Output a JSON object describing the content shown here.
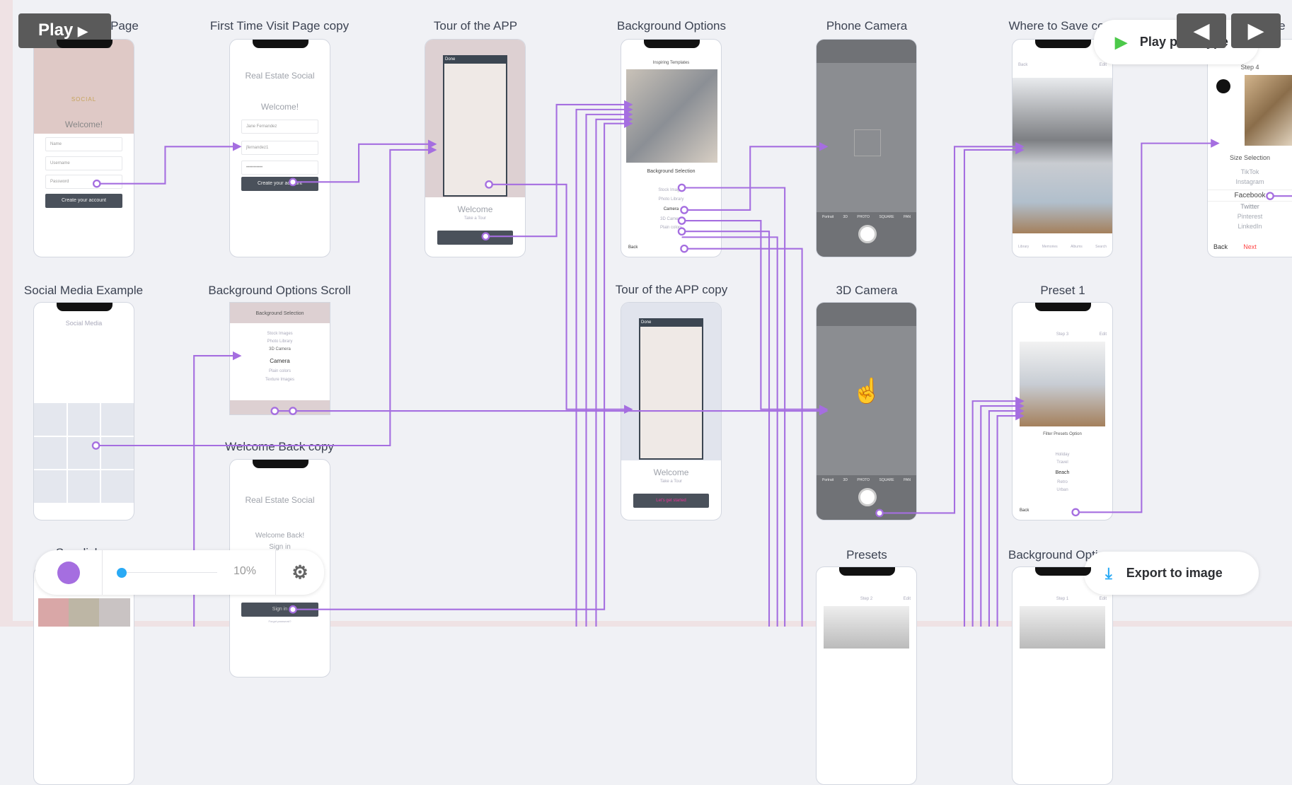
{
  "screens": {
    "s1": {
      "title": "First Time Visit Page",
      "brand": "SOCIAL",
      "welcome": "Welcome!",
      "name": "Name",
      "username": "Username",
      "password": "Password",
      "button": "Create your account"
    },
    "s2": {
      "title": "First Time Visit Page copy",
      "app": "Real Estate Social",
      "welcome": "Welcome!",
      "name": "Jane Fernandez",
      "username": "jfernandez1",
      "password": "•••••••••••",
      "button": "Create your account"
    },
    "s3": {
      "title": "Tour of the APP",
      "done": "Done",
      "welcome": "Welcome",
      "tour": "Take a Tour"
    },
    "s4": {
      "title": "Background Options",
      "header": "Inspiring Templates",
      "selection": "Background Selection",
      "items": [
        "Stock Images",
        "Photo Library",
        "Camera",
        "3D Camera",
        "Plain colors"
      ],
      "back": "Back"
    },
    "s5": {
      "title": "Phone Camera",
      "modes": [
        "Portrait",
        "3D",
        "PHOTO",
        "SQUARE",
        "PAN"
      ]
    },
    "s6": {
      "title": "Where to Save copy",
      "back": "Back",
      "edit": "Edit",
      "tabs": [
        "Library",
        "Memories",
        "Albums",
        "Search"
      ]
    },
    "s7": {
      "title": "Size",
      "step": "Step 4",
      "selection": "Size Selection",
      "items": [
        "TikTok",
        "Instagram",
        "Facebook",
        "Twitter",
        "Pinterest",
        "LinkedIn"
      ],
      "back": "Back",
      "next": "Next"
    },
    "s8": {
      "title": "Social Media Example",
      "header": "Social Media"
    },
    "s9": {
      "title": "Background Options Scroll",
      "header": "Background Selection",
      "items": [
        "Stock Images",
        "Photo Library",
        "3D Camera",
        "Camera",
        "Plain colors",
        "Texture Images"
      ]
    },
    "s10": {
      "title": "Tour of the APP copy",
      "done": "Done",
      "welcome": "Welcome",
      "tour": "Take a Tour",
      "button": "Let's get started"
    },
    "s11": {
      "title": "3D Camera",
      "modes": [
        "Portrait",
        "3D",
        "PHOTO",
        "SQUARE",
        "PAN"
      ]
    },
    "s12": {
      "title": "Preset 1",
      "step": "Step 3",
      "edit": "Edit",
      "filter": "Filter Presets Option",
      "items": [
        "Holiday",
        "Travel",
        "Beach",
        "Retro",
        "Urban"
      ],
      "back": "Back"
    },
    "s13": {
      "title": "Welcome Back copy",
      "app": "Real Estate Social",
      "welcome": "Welcome Back!",
      "signin": "Sign in",
      "button": "Sign in",
      "forgot": "Forgot password?"
    },
    "s14": {
      "title": "Presets",
      "step": "Step 2",
      "edit": "Edit"
    },
    "s15": {
      "title": "Background Options",
      "step": "Step 1",
      "edit": "Edit"
    },
    "s16": {
      "title": "Swedish..."
    }
  },
  "controls": {
    "play": "Play",
    "play_prototype": "Play prototype",
    "export": "Export to image",
    "zoom": "10%",
    "zoom_fraction": 0.1,
    "link_color": "#a56ee0",
    "accent_green": "#4cc94a",
    "slider_color": "#2aaaf5"
  }
}
